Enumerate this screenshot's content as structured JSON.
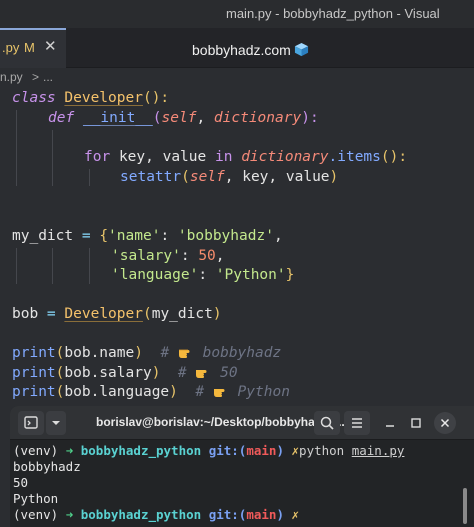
{
  "window": {
    "title": "main.py - bobbyhadz_python - Visual"
  },
  "tab": {
    "name": ".py",
    "modified": "M",
    "close": "✕"
  },
  "overlay": {
    "site": "bobbyhadz.com"
  },
  "breadcrumb": {
    "file": "n.py",
    "sep": ">",
    "more": "..."
  },
  "code": {
    "l1": {
      "kw": "class",
      "name": "Developer",
      "tail": "():"
    },
    "l2": {
      "kw": "def",
      "fn": "__init__",
      "self": "self",
      "comma": ",",
      "param": "dictionary",
      "tail": "):"
    },
    "l4": {
      "kw": "for",
      "vars": "key, value",
      "in": "in",
      "obj": "dictionary",
      "method": ".items",
      "tail": "():"
    },
    "l5": {
      "fn": "setattr",
      "self": "self",
      "rest": ", key, value",
      "tail": ")"
    },
    "l8": {
      "name": "my_dict",
      "eq": " = ",
      "brace": "{",
      "key": "'name'",
      "colon": ": ",
      "val": "'bobbyhadz'",
      "comma": ","
    },
    "l9": {
      "key": "'salary'",
      "colon": ": ",
      "val": "50",
      "comma": ","
    },
    "l10": {
      "key": "'language'",
      "colon": ": ",
      "val": "'Python'",
      "brace": "}"
    },
    "l12": {
      "name": "bob",
      "eq": " = ",
      "cls": "Developer",
      "arg": "my_dict"
    },
    "l14": {
      "fn": "print",
      "arg": "bob.name",
      "cmt": "# ",
      "out": " bobbyhadz"
    },
    "l15": {
      "fn": "print",
      "arg": "bob.salary",
      "cmt": "# ",
      "out": " 50"
    },
    "l16": {
      "fn": "print",
      "arg": "bob.language",
      "cmt": "# ",
      "out": " Python"
    }
  },
  "terminal": {
    "title": "borislav@borislav:~/Desktop/bobbyhadz_...",
    "prompt_venv": "(venv)",
    "prompt_arrow": "➜",
    "prompt_dir": "bobbyhadz_python",
    "prompt_git": "git:(",
    "prompt_branch": "main",
    "prompt_git_close": ")",
    "prompt_x": "✗",
    "command": "python",
    "command_file": "main.py",
    "output": [
      "bobbyhadz",
      "50",
      "Python"
    ]
  },
  "colors": {
    "background": "#2b2d31",
    "keyword": "#c792ea",
    "class": "#f5c26b",
    "string": "#c3e88d",
    "number": "#f78c6c",
    "function": "#82aaff",
    "terminal_bg": "#222426"
  }
}
